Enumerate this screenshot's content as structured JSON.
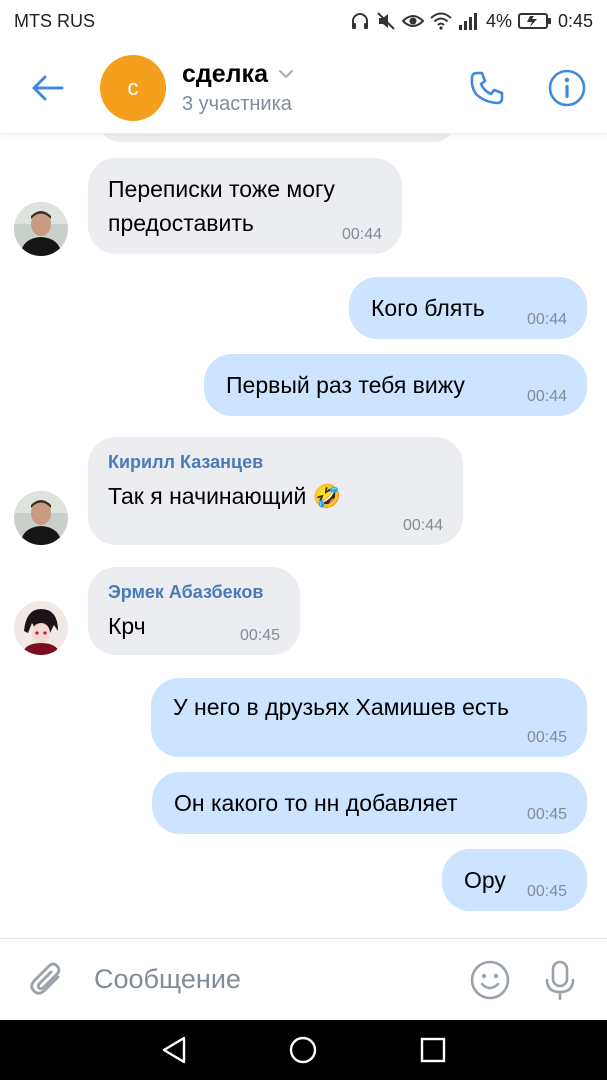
{
  "status_bar": {
    "carrier": "MTS RUS",
    "battery": "4%",
    "time": "0:45"
  },
  "header": {
    "avatar_letter": "с",
    "title": "сделка",
    "subtitle": "3 участника",
    "accent": "#3f8ae0"
  },
  "messages": [
    {
      "direction": "in",
      "sender": "",
      "text_lines": [
        "Переписки тоже могу",
        "предоставить"
      ],
      "time": "00:44",
      "avatar": true
    },
    {
      "direction": "out",
      "text_lines": [
        "Кого блять"
      ],
      "time": "00:44"
    },
    {
      "direction": "out",
      "text_lines": [
        "Первый раз тебя вижу"
      ],
      "time": "00:44"
    },
    {
      "direction": "in",
      "sender": "Кирилл Казанцев",
      "text_lines": [
        "Так я начинающий 🤣"
      ],
      "time": "00:44",
      "avatar": true
    },
    {
      "direction": "in",
      "sender": "Эрмек Абазбеков",
      "text_lines": [
        "Крч"
      ],
      "time": "00:45",
      "avatar": true
    },
    {
      "direction": "out",
      "text_lines": [
        "У него в друзьях Хамишев есть"
      ],
      "time": "00:45"
    },
    {
      "direction": "out",
      "text_lines": [
        "Он какого то нн добавляет"
      ],
      "time": "00:45"
    },
    {
      "direction": "out",
      "text_lines": [
        "Ору"
      ],
      "time": "00:45"
    }
  ],
  "composer": {
    "placeholder": "Сообщение"
  },
  "colors": {
    "incoming_bubble": "#ebedf0",
    "outgoing_bubble": "#cce4ff",
    "sender_name": "#4a7ab8",
    "avatar_orange": "#f4a01d"
  }
}
